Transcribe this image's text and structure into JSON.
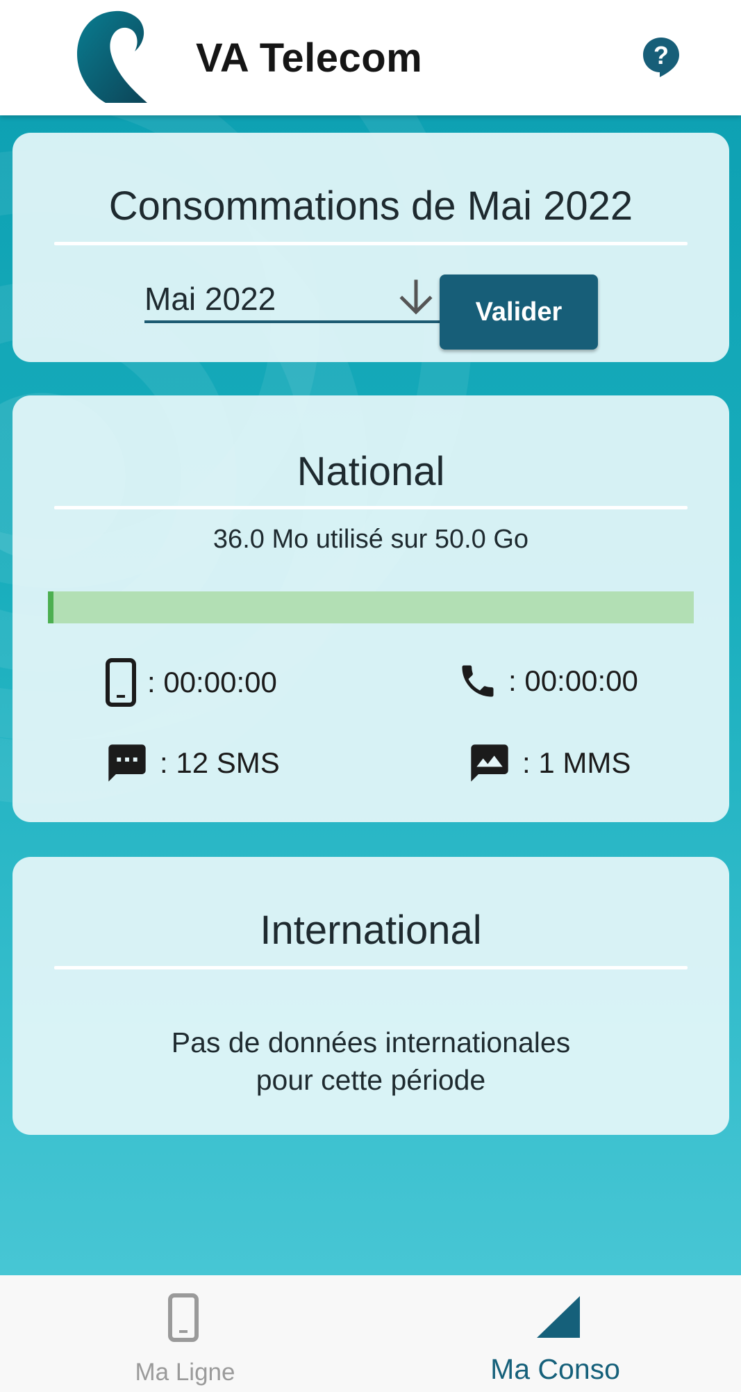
{
  "header": {
    "title": "VA Telecom",
    "logo_icon": "va-telecom-logo-icon",
    "help_icon": "help-icon"
  },
  "colors": {
    "brand_dark": "#175e78",
    "background_teal": "#19aebd",
    "progress_track": "#b2dfb4",
    "progress_fill": "#4caf50",
    "nav_active": "#15607a",
    "nav_inactive": "#9a9a9a"
  },
  "period": {
    "title": "Consommations de Mai 2022",
    "selected_month": "Mai 2022",
    "validate_label": "Valider"
  },
  "national": {
    "title": "National",
    "usage_text": "36.0 Mo utilisé sur 50.0 Go",
    "usage_fraction": 0.0007,
    "stats": {
      "mobile_calls": ": 00:00:00",
      "landline_calls": ": 00:00:00",
      "sms": ": 12 SMS",
      "mms": ": 1 MMS"
    }
  },
  "international": {
    "title": "International",
    "message": "Pas de données internationales\npour cette période"
  },
  "bottom_nav": {
    "items": [
      {
        "label": "Ma Ligne",
        "icon": "smartphone-icon",
        "active": false
      },
      {
        "label": "Ma Conso",
        "icon": "signal-icon",
        "active": true
      }
    ]
  }
}
